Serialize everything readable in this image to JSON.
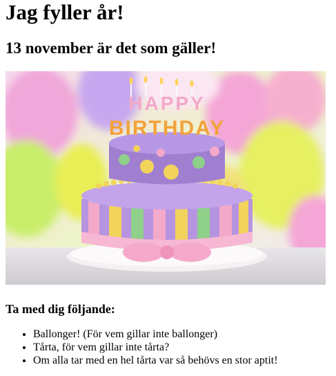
{
  "page": {
    "heading": "Jag fyller år!",
    "subheading": "13 november är det som gäller!",
    "image": {
      "subject": "birthday-cake-with-balloons",
      "topper_text": [
        "HAPPY",
        "BIRTHDAY"
      ]
    },
    "list_title": "Ta med dig följande:",
    "items": [
      "Ballonger! (För vem gillar inte ballonger)",
      "Tårta, för vem gillar inte tårta?",
      "Om alla tar med en hel tårta var så behövs en stor aptit!"
    ]
  },
  "colors": {
    "text": "#000000",
    "background": "#ffffff",
    "cake_purple": "#a07fd0",
    "cake_pink": "#f3a9c9",
    "cake_yellow": "#f2d35c",
    "cake_green": "#8fd08a",
    "balloon_yellow": "#e9ee55",
    "balloon_pink": "#f4a6d6",
    "balloon_purple": "#c7a7ef"
  }
}
